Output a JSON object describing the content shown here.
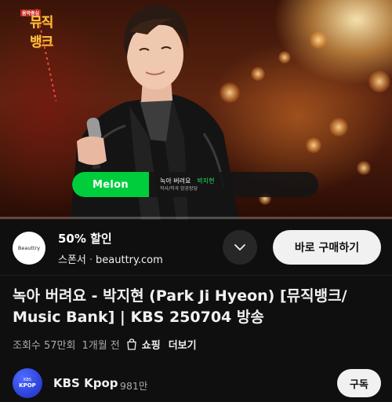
{
  "video": {
    "show_logo": {
      "small": "음악중심",
      "main": "뮤직뱅크"
    },
    "melon": {
      "logo": "Melon",
      "song": "녹아 버려요",
      "artist": "박지현",
      "credits": "작사/작곡 앙공장당"
    },
    "progress": 0.0
  },
  "ad": {
    "avatar_text": "Beauttry",
    "title": "50% 할인",
    "sponsor_label": "스폰서",
    "separator": "·",
    "domain": "beauttry.com",
    "buy_label": "바로 구매하기"
  },
  "video_title": "녹아 버려요 - 박지현 (Park Ji Hyeon) [뮤직뱅크/ Music Bank] | KBS 250704 방송",
  "meta": {
    "views": "조회수 57만회",
    "age": "1개월 전",
    "shopping": "쇼핑",
    "more": "더보기"
  },
  "channel": {
    "avatar_top": "KBS",
    "avatar_bottom": "KPOP",
    "name": "KBS Kpop",
    "subscribers": "981만",
    "subscribe_label": "구독"
  },
  "colors": {
    "background": "#0f0f0f",
    "melon_green": "#00cd3c",
    "progress_red": "#ff0000",
    "channel_blue": "#2a3fd6"
  }
}
